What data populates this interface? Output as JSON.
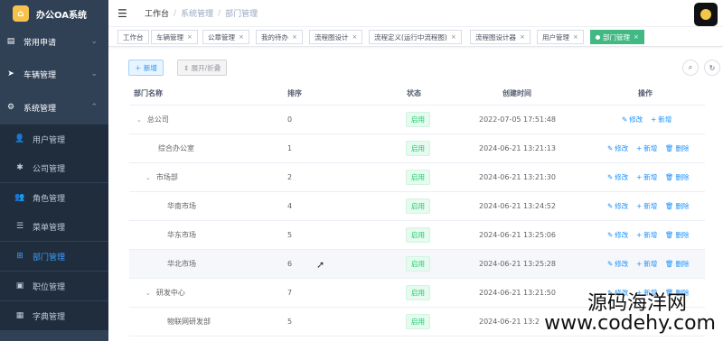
{
  "app": {
    "title": "办公OA系统"
  },
  "sidebar": {
    "groups": [
      {
        "label": "常用申请",
        "icon": "list-icon",
        "chevron": "⌄"
      },
      {
        "label": "车辆管理",
        "icon": "send-icon",
        "chevron": "⌄"
      },
      {
        "label": "系统管理",
        "icon": "gear-icon",
        "chevron": "⌃"
      }
    ],
    "items": [
      {
        "label": "用户管理",
        "icon": "user-icon"
      },
      {
        "label": "公司管理",
        "icon": "bug-icon"
      },
      {
        "label": "角色管理",
        "icon": "users-icon"
      },
      {
        "label": "菜单管理",
        "icon": "menu-icon"
      },
      {
        "label": "部门管理",
        "icon": "sitemap-icon",
        "active": true
      },
      {
        "label": "职位管理",
        "icon": "post-icon"
      },
      {
        "label": "字典管理",
        "icon": "book-icon"
      }
    ]
  },
  "breadcrumb": {
    "root": "工作台",
    "sep": "/",
    "parent": "系统管理",
    "current": "部门管理"
  },
  "tags": [
    {
      "label": "工作台"
    },
    {
      "label": "车辆管理",
      "close": "×"
    },
    {
      "label": "公章管理",
      "close": "×"
    },
    {
      "label": "我的待办",
      "close": "×"
    },
    {
      "label": "流程图设计",
      "close": "×"
    },
    {
      "label": "流程定义(运行中流程图)",
      "close": "×"
    },
    {
      "label": "流程图设计器",
      "close": "×"
    },
    {
      "label": "用户管理",
      "close": "×"
    },
    {
      "label": "部门管理",
      "close": "×",
      "active": true
    }
  ],
  "toolbar": {
    "add": "＋ 新增",
    "toggle": "⇕ 展开/折叠"
  },
  "table": {
    "headers": {
      "name": "部门名称",
      "order": "排序",
      "status": "状态",
      "created": "创建时间",
      "ops": "操作"
    },
    "rows": [
      {
        "name": "总公司",
        "arrow": "⌄",
        "order": "0",
        "status": "启用",
        "created": "2022-07-05 17:51:48",
        "ops": [
          "修改",
          "新增"
        ]
      },
      {
        "name": "综合办公室",
        "arrow": "",
        "order": "1",
        "status": "启用",
        "created": "2024-06-21 13:21:13",
        "ops": [
          "修改",
          "新增",
          "删除"
        ]
      },
      {
        "name": "市场部",
        "arrow": "⌄",
        "order": "2",
        "status": "启用",
        "created": "2024-06-21 13:21:30",
        "ops": [
          "修改",
          "新增",
          "删除"
        ]
      },
      {
        "name": "华南市场",
        "arrow": "",
        "order": "4",
        "status": "启用",
        "created": "2024-06-21 13:24:52",
        "ops": [
          "修改",
          "新增",
          "删除"
        ]
      },
      {
        "name": "华东市场",
        "arrow": "",
        "order": "5",
        "status": "启用",
        "created": "2024-06-21 13:25:06",
        "ops": [
          "修改",
          "新增",
          "删除"
        ]
      },
      {
        "name": "华北市场",
        "arrow": "",
        "order": "6",
        "status": "启用",
        "created": "2024-06-21 13:25:28",
        "ops": [
          "修改",
          "新增",
          "删除"
        ]
      },
      {
        "name": "研发中心",
        "arrow": "⌄",
        "order": "7",
        "status": "启用",
        "created": "2024-06-21 13:21:50",
        "ops": [
          "修改",
          "新增",
          "删除"
        ]
      },
      {
        "name": "物联网研发部",
        "arrow": "",
        "order": "5",
        "status": "启用",
        "created": "2024-06-21 13:2",
        "ops": []
      }
    ]
  },
  "watermark": {
    "line1": "源码海洋网",
    "line2": "www.codehy.com"
  }
}
